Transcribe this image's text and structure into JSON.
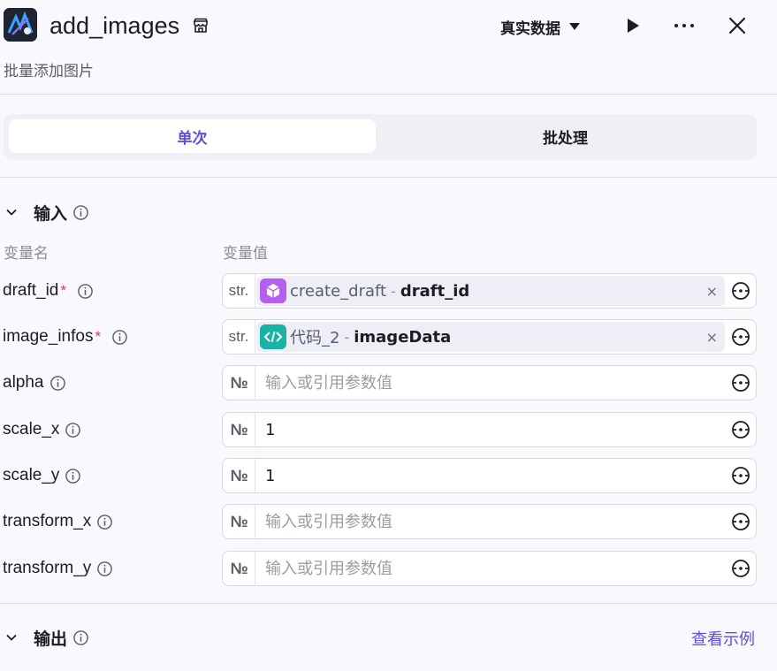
{
  "header": {
    "title": "add_images",
    "subtitle": "批量添加图片",
    "data_mode": "真实数据"
  },
  "tabs": [
    {
      "label": "单次",
      "active": true
    },
    {
      "label": "批处理",
      "active": false
    }
  ],
  "input_section": {
    "title": "输入",
    "col_name": "变量名",
    "col_value": "变量值",
    "rows": [
      {
        "name": "draft_id",
        "required": "*",
        "type": "str.",
        "ref_node": "create_draft",
        "ref_sep": "-",
        "ref_var": "draft_id",
        "clear": "×"
      },
      {
        "name": "image_infos",
        "required": "*",
        "type": "str.",
        "ref_node": "代码_2",
        "ref_sep": "-",
        "ref_var": "imageData",
        "clear": "×"
      },
      {
        "name": "alpha",
        "type": "№",
        "value": "",
        "placeholder": "输入或引用参数值"
      },
      {
        "name": "scale_x",
        "type": "№",
        "value": "1",
        "placeholder": "输入或引用参数值"
      },
      {
        "name": "scale_y",
        "type": "№",
        "value": "1",
        "placeholder": "输入或引用参数值"
      },
      {
        "name": "transform_x",
        "type": "№",
        "value": "",
        "placeholder": "输入或引用参数值"
      },
      {
        "name": "transform_y",
        "type": "№",
        "value": "",
        "placeholder": "输入或引用参数值"
      }
    ]
  },
  "output_section": {
    "title": "输出",
    "view_example": "查看示例"
  },
  "colors": {
    "accent": "#5a4fde",
    "required": "#e5324d",
    "node_purple": "#b45ff0",
    "node_teal": "#19b3a6"
  }
}
